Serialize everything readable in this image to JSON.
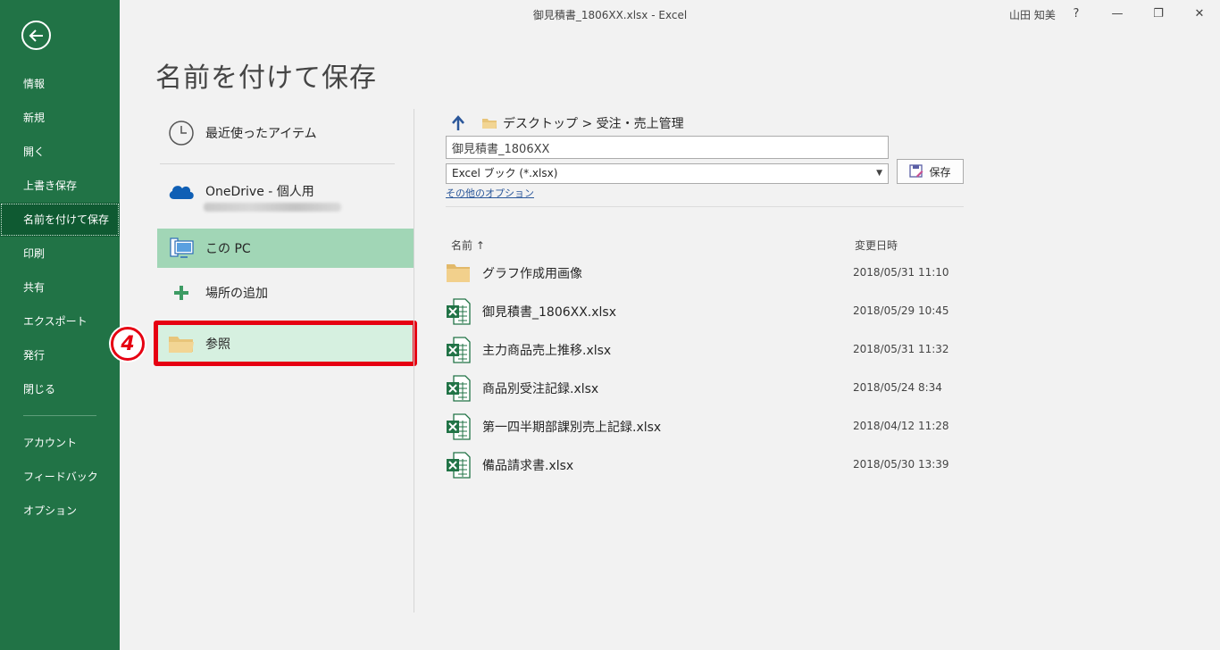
{
  "window": {
    "title": "御見積書_1806XX.xlsx  -  Excel",
    "user": "山田 知美",
    "help": "?",
    "minimize": "—",
    "restore": "❐",
    "close": "✕"
  },
  "sidebar": {
    "items": [
      {
        "label": "情報"
      },
      {
        "label": "新規"
      },
      {
        "label": "開く"
      },
      {
        "label": "上書き保存"
      },
      {
        "label": "名前を付けて保存"
      },
      {
        "label": "印刷"
      },
      {
        "label": "共有"
      },
      {
        "label": "エクスポート"
      },
      {
        "label": "発行"
      },
      {
        "label": "閉じる"
      },
      {
        "label": "アカウント"
      },
      {
        "label": "フィードバック"
      },
      {
        "label": "オプション"
      }
    ],
    "active_index": 4,
    "accent": "#217346"
  },
  "page": {
    "title": "名前を付けて保存"
  },
  "locations": {
    "recent": "最近使ったアイテム",
    "onedrive": "OneDrive - 個人用",
    "this_pc": "この PC",
    "add_place": "場所の追加",
    "browse": "参照",
    "selected": "この PC"
  },
  "annotation": {
    "step": "4",
    "color": "#e60012"
  },
  "save_panel": {
    "path": "デスクトップ > 受注・売上管理",
    "filename": "御見積書_1806XX",
    "filetype": "Excel ブック (*.xlsx)",
    "save_label": "保存",
    "more_options": "その他のオプション",
    "col_name": "名前 ↑",
    "col_date": "変更日時"
  },
  "files": [
    {
      "name": "グラフ作成用画像",
      "date": "2018/05/31 11:10",
      "icon": "folder-icon"
    },
    {
      "name": "御見積書_1806XX.xlsx",
      "date": "2018/05/29 10:45",
      "icon": "excel-file-icon"
    },
    {
      "name": "主力商品売上推移.xlsx",
      "date": "2018/05/31 11:32",
      "icon": "excel-file-icon"
    },
    {
      "name": "商品別受注記録.xlsx",
      "date": "2018/05/24 8:34",
      "icon": "excel-file-icon"
    },
    {
      "name": "第一四半期部課別売上記録.xlsx",
      "date": "2018/04/12 11:28",
      "icon": "excel-file-icon"
    },
    {
      "name": "備品請求書.xlsx",
      "date": "2018/05/30 13:39",
      "icon": "excel-file-icon"
    }
  ]
}
